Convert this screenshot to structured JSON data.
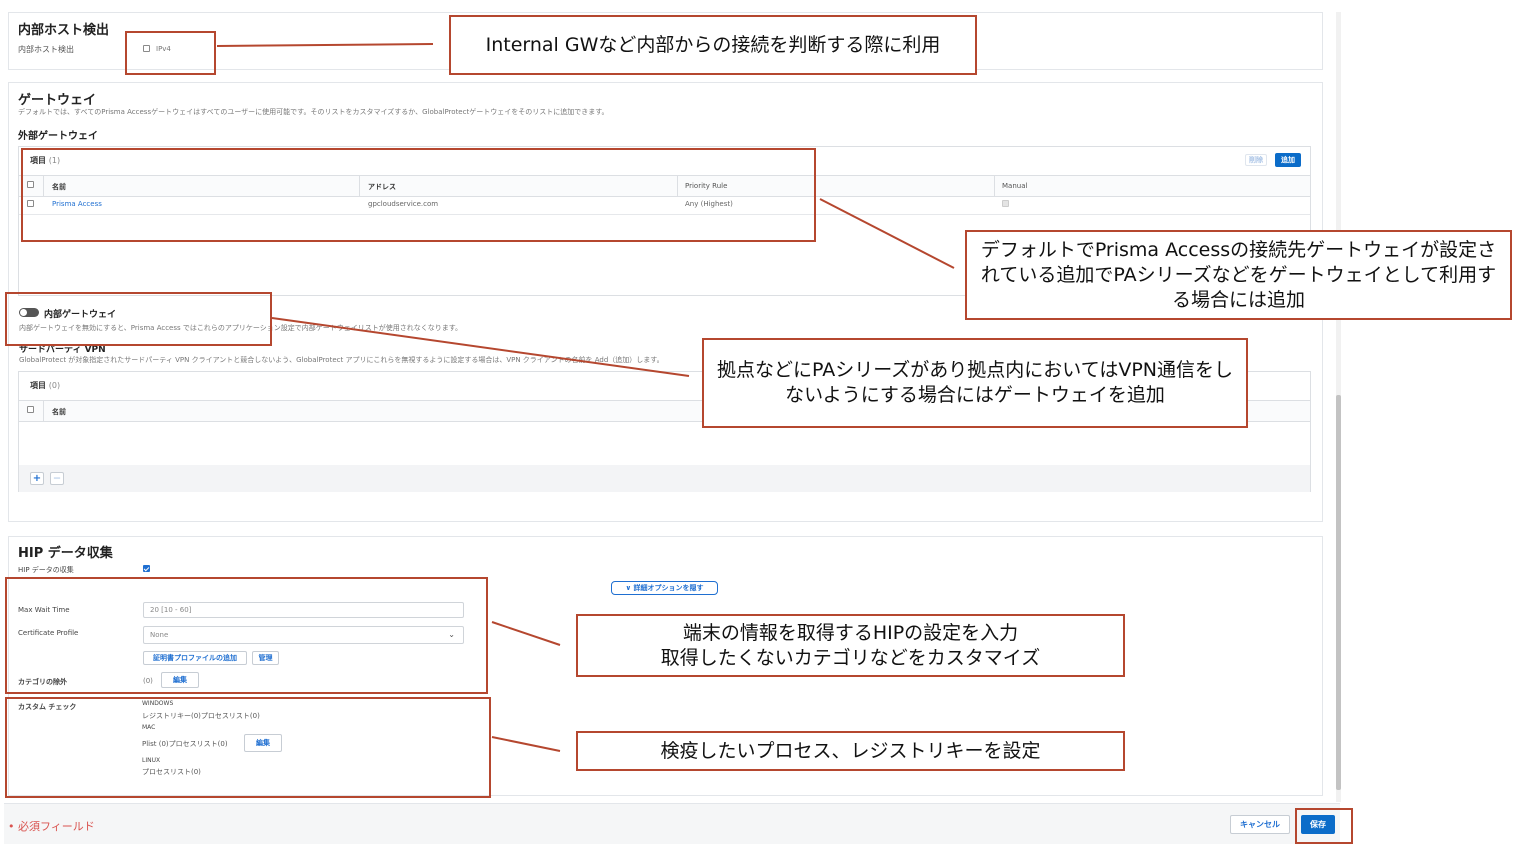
{
  "internal_host": {
    "title": "内部ホスト検出",
    "field_label": "内部ホスト検出",
    "ipv4_label": "IPv4"
  },
  "gateways": {
    "title": "ゲートウェイ",
    "description": "デフォルトでは、すべてのPrisma Accessゲートウェイはすべてのユーザーに使用可能です。そのリストをカスタマイズするか、GlobalProtectゲートウェイをそのリストに追加できます。",
    "external": {
      "title": "外部ゲートウェイ",
      "items_label": "項目",
      "items_count": "(1)",
      "delete_label": "削除",
      "add_label": "追加",
      "columns": [
        "名前",
        "アドレス",
        "Priority Rule",
        "Manual"
      ],
      "rows": [
        {
          "name": "Prisma Access",
          "address": "gpcloudservice.com",
          "priority": "Any (Highest)"
        }
      ]
    },
    "internal": {
      "title": "内部ゲートウェイ",
      "description": "内部ゲートウェイを無効にすると、Prisma Access ではこれらのアプリケーション設定で内部ゲートウェイリストが使用されなくなります。"
    },
    "third_party": {
      "title": "サードパーティ VPN",
      "description": "GlobalProtect が対象指定されたサードパーティ VPN クライアントと競合しないよう、GlobalProtect アプリにこれらを無視するように設定する場合は、VPN クライアントの名前を Add（追加）します。",
      "items_label": "項目",
      "items_count": "(0)",
      "column": "名前",
      "plus": "+",
      "minus": "—"
    }
  },
  "hip": {
    "title": "HIP データ収集",
    "collect_label": "HIP データの収集",
    "advanced_toggle": "∨ 詳細オプションを隠す",
    "max_wait_label": "Max Wait Time",
    "max_wait_value": "20 [10 - 60]",
    "cert_profile_label": "Certificate Profile",
    "cert_profile_value": "None",
    "add_cert_button": "証明書プロファイルの追加",
    "manage_button": "管理",
    "exclude_label": "カテゴリの除外",
    "exclude_count": "(0)",
    "edit_button": "編集",
    "custom_check_label": "カスタム チェック",
    "windows_label": "WINDOWS",
    "windows_value": "レジストリキー(0)プロセスリスト(0)",
    "mac_label": "MAC",
    "mac_value": "Plist (0)プロセスリスト(0)",
    "mac_edit": "編集",
    "linux_label": "LINUX",
    "linux_value": "プロセスリスト(0)"
  },
  "footer": {
    "required_mark": "•",
    "required_label": "必須フィールド",
    "cancel": "キャンセル",
    "save": "保存"
  },
  "annotations": {
    "a1": "Internal GWなど内部からの接続を判断する際に利用",
    "a2": "デフォルトでPrisma Accessの接続先ゲートウェイが設定されている追加でPAシリーズなどをゲートウェイとして利用する場合には追加",
    "a3": "拠点などにPAシリーズがあり拠点内においてはVPN通信をしないようにする場合にはゲートウェイを追加",
    "a4_line1": "端末の情報を取得するHIPの設定を入力",
    "a4_line2": "取得したくないカテゴリなどをカスタマイズ",
    "a5": "検疫したいプロセス、レジストリキーを設定"
  },
  "colors": {
    "accent": "#0b6cc9",
    "annotation_border": "#b5472f",
    "required": "#d9534f"
  }
}
